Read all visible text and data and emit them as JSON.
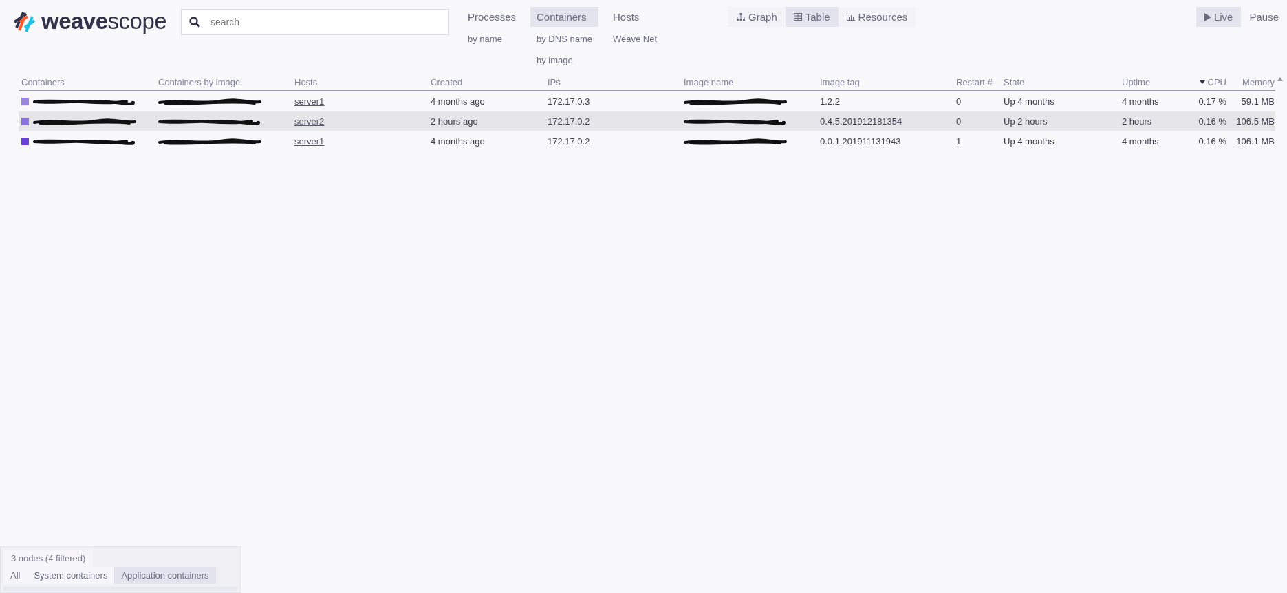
{
  "logo": {
    "bold": "weave",
    "light": "scope"
  },
  "search": {
    "placeholder": "search"
  },
  "topologies": [
    {
      "label": "Processes",
      "selected": false,
      "sub": [
        {
          "label": "by name",
          "selected": false
        }
      ]
    },
    {
      "label": "Containers",
      "selected": true,
      "sub": [
        {
          "label": "by DNS name",
          "selected": false
        },
        {
          "label": "by image",
          "selected": false
        }
      ]
    },
    {
      "label": "Hosts",
      "selected": false,
      "sub": [
        {
          "label": "Weave Net",
          "selected": false
        }
      ]
    }
  ],
  "views": [
    {
      "label": "Graph",
      "kind": "graph",
      "selected": false
    },
    {
      "label": "Table",
      "kind": "table",
      "selected": true
    },
    {
      "label": "Resources",
      "kind": "resources",
      "selected": false
    }
  ],
  "playback": [
    {
      "label": "Live",
      "kind": "play",
      "selected": true
    },
    {
      "label": "Pause",
      "kind": "pause",
      "selected": false
    }
  ],
  "table": {
    "columns": [
      {
        "label": "Containers",
        "sorted": false
      },
      {
        "label": "Containers by image",
        "sorted": false
      },
      {
        "label": "Hosts",
        "sorted": false
      },
      {
        "label": "Created",
        "sorted": false
      },
      {
        "label": "IPs",
        "sorted": false
      },
      {
        "label": "Image name",
        "sorted": false
      },
      {
        "label": "Image tag",
        "sorted": false
      },
      {
        "label": "Restart #",
        "sorted": false
      },
      {
        "label": "State",
        "sorted": false
      },
      {
        "label": "Uptime",
        "sorted": false
      },
      {
        "label": "CPU",
        "sorted": true
      },
      {
        "label": "Memory",
        "sorted": false
      }
    ],
    "rows": [
      {
        "color": "#9a86e0",
        "selected": false,
        "cells": [
          {
            "redacted": true
          },
          {
            "redacted": true
          },
          {
            "text": "server1",
            "kind": "link"
          },
          {
            "text": "4 months ago"
          },
          {
            "text": "172.17.0.3"
          },
          {
            "redacted": true
          },
          {
            "text": "1.2.2"
          },
          {
            "text": "0"
          },
          {
            "text": "Up 4 months"
          },
          {
            "text": "4 months"
          },
          {
            "text": "0.17 %",
            "kind": "number"
          },
          {
            "text": "59.1 MB",
            "kind": "number"
          }
        ]
      },
      {
        "color": "#8a72e0",
        "selected": true,
        "cells": [
          {
            "redacted": true
          },
          {
            "redacted": true
          },
          {
            "text": "server2",
            "kind": "link"
          },
          {
            "text": "2 hours ago"
          },
          {
            "text": "172.17.0.2"
          },
          {
            "redacted": true
          },
          {
            "text": "0.4.5.201912181354"
          },
          {
            "text": "0"
          },
          {
            "text": "Up 2 hours"
          },
          {
            "text": "2 hours"
          },
          {
            "text": "0.16 %",
            "kind": "number"
          },
          {
            "text": "106.5 MB",
            "kind": "number"
          }
        ]
      },
      {
        "color": "#6a40d8",
        "selected": false,
        "cells": [
          {
            "redacted": true
          },
          {
            "redacted": true
          },
          {
            "text": "server1",
            "kind": "link"
          },
          {
            "text": "4 months ago"
          },
          {
            "text": "172.17.0.2"
          },
          {
            "redacted": true
          },
          {
            "text": "0.0.1.201911131943"
          },
          {
            "text": "1"
          },
          {
            "text": "Up 4 months"
          },
          {
            "text": "4 months"
          },
          {
            "text": "0.16 %",
            "kind": "number"
          },
          {
            "text": "106.1 MB",
            "kind": "number"
          }
        ]
      }
    ]
  },
  "filter": {
    "status": "3 nodes (4 filtered)",
    "options": [
      {
        "label": "All",
        "selected": false
      },
      {
        "label": "System containers",
        "selected": false
      },
      {
        "label": "Application containers",
        "selected": true
      }
    ]
  }
}
